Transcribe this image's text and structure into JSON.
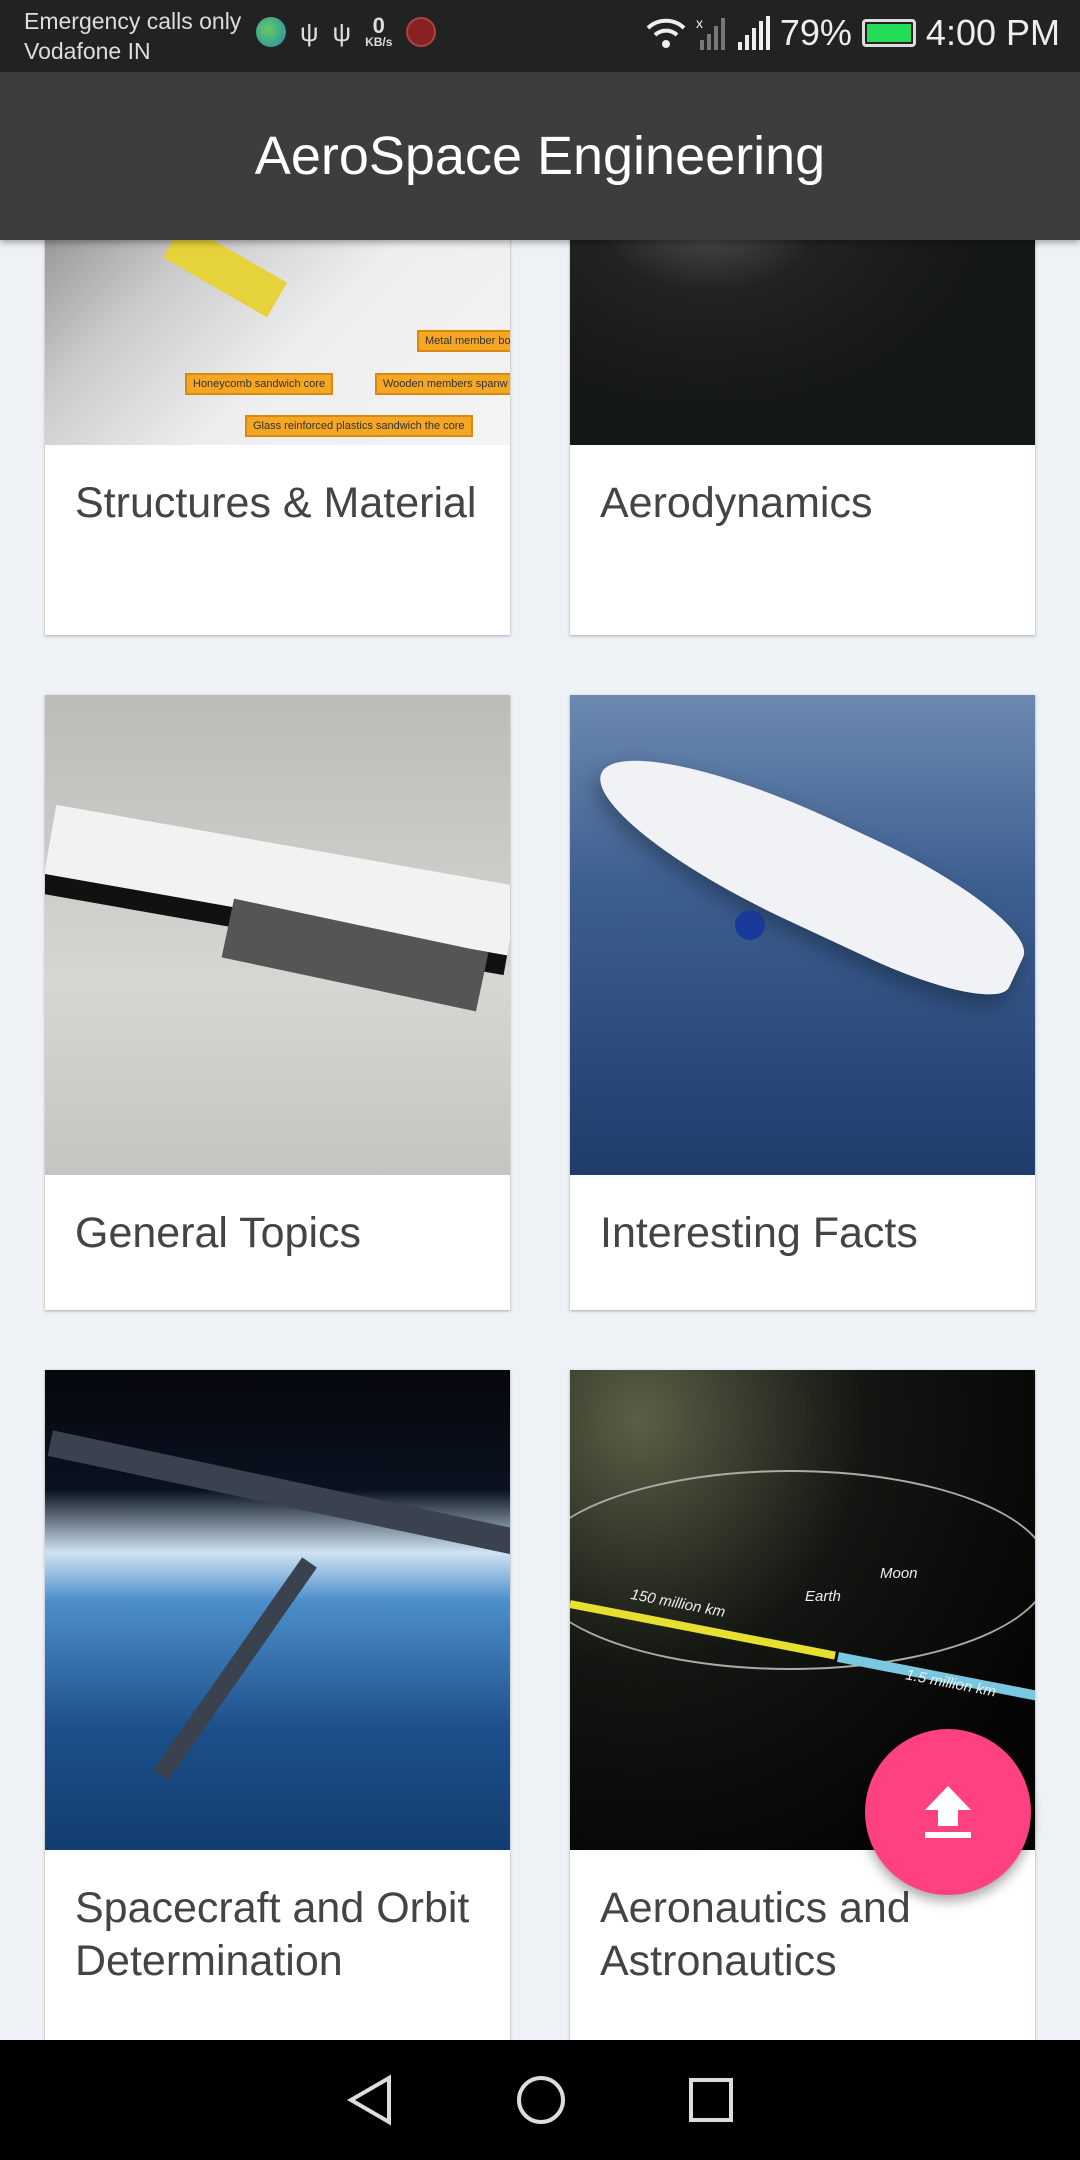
{
  "status_bar": {
    "carrier_line1": "Emergency calls only",
    "carrier_line2": "Vodafone IN",
    "net_speed_value": "0",
    "net_speed_unit": "KB/s",
    "battery": "79%",
    "battery_level": 79,
    "time": "4:00 PM",
    "icons": [
      "globe-icon",
      "usb-icon",
      "usb-icon",
      "call-recorder-icon",
      "wifi-icon",
      "signal-off-icon",
      "signal-icon",
      "battery-charging-icon"
    ]
  },
  "app_bar": {
    "title": "AeroSpace Engineering"
  },
  "cards": [
    {
      "title": "Structures & Material",
      "image_labels": [
        "Metal member bo",
        "Honeycomb sandwich core",
        "Wooden members spanw",
        "Glass reinforced plastics sandwich the core"
      ]
    },
    {
      "title": "Aerodynamics"
    },
    {
      "title": "General Topics"
    },
    {
      "title": "Interesting Facts"
    },
    {
      "title": "Spacecraft and Orbit Determination"
    },
    {
      "title": "Aeronautics and Astronautics",
      "image_labels": [
        "150 million km",
        "Earth",
        "Moon",
        "1.5 million km"
      ]
    }
  ],
  "fab": {
    "icon": "upload-arrow-icon",
    "color": "#ff4081"
  },
  "nav_bar": {
    "icons": [
      "back-icon",
      "home-icon",
      "recents-icon"
    ]
  }
}
